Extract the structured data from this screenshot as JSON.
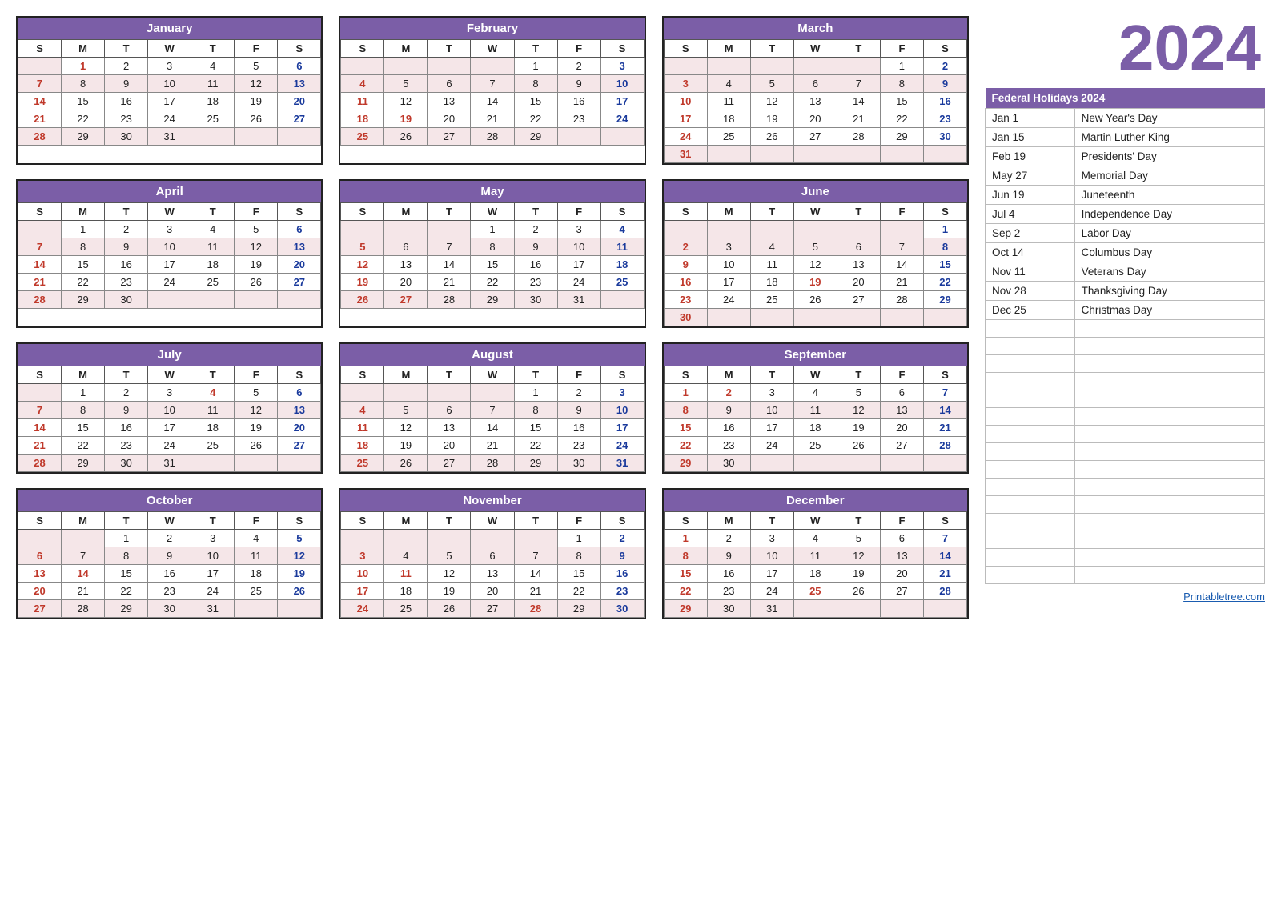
{
  "year": "2024",
  "sidebar": {
    "holidays_header": "Federal Holidays 2024",
    "holidays": [
      {
        "date": "Jan 1",
        "name": "New Year's Day"
      },
      {
        "date": "Jan 15",
        "name": "Martin Luther King"
      },
      {
        "date": "Feb 19",
        "name": "Presidents' Day"
      },
      {
        "date": "May 27",
        "name": "Memorial Day"
      },
      {
        "date": "Jun 19",
        "name": "Juneteenth"
      },
      {
        "date": "Jul 4",
        "name": "Independence Day"
      },
      {
        "date": "Sep 2",
        "name": "Labor Day"
      },
      {
        "date": "Oct 14",
        "name": "Columbus Day"
      },
      {
        "date": "Nov 11",
        "name": "Veterans Day"
      },
      {
        "date": "Nov 28",
        "name": "Thanksgiving Day"
      },
      {
        "date": "Dec 25",
        "name": "Christmas Day"
      }
    ],
    "website": "Printabletree.com"
  },
  "months": [
    {
      "name": "January",
      "weeks": [
        [
          "",
          "1",
          "2",
          "3",
          "4",
          "5",
          "6"
        ],
        [
          "7",
          "8",
          "9",
          "10",
          "11",
          "12",
          "13"
        ],
        [
          "14",
          "15",
          "16",
          "17",
          "18",
          "19",
          "20"
        ],
        [
          "21",
          "22",
          "23",
          "24",
          "25",
          "26",
          "27"
        ],
        [
          "28",
          "29",
          "30",
          "31",
          "",
          "",
          ""
        ]
      ],
      "holidays": [
        "1"
      ],
      "sundays": [
        "7",
        "14",
        "21",
        "28"
      ],
      "saturdays": [
        "6",
        "13",
        "20",
        "27"
      ]
    },
    {
      "name": "February",
      "weeks": [
        [
          "",
          "",
          "",
          "",
          "1",
          "2",
          "3"
        ],
        [
          "4",
          "5",
          "6",
          "7",
          "8",
          "9",
          "10"
        ],
        [
          "11",
          "12",
          "13",
          "14",
          "15",
          "16",
          "17"
        ],
        [
          "18",
          "19",
          "20",
          "21",
          "22",
          "23",
          "24"
        ],
        [
          "25",
          "26",
          "27",
          "28",
          "29",
          "",
          ""
        ]
      ],
      "holidays": [
        "19"
      ],
      "sundays": [
        "4",
        "11",
        "18",
        "25"
      ],
      "saturdays": [
        "3",
        "10",
        "17",
        "24"
      ]
    },
    {
      "name": "March",
      "weeks": [
        [
          "",
          "",
          "",
          "",
          "",
          "1",
          "2"
        ],
        [
          "3",
          "4",
          "5",
          "6",
          "7",
          "8",
          "9"
        ],
        [
          "10",
          "11",
          "12",
          "13",
          "14",
          "15",
          "16"
        ],
        [
          "17",
          "18",
          "19",
          "20",
          "21",
          "22",
          "23"
        ],
        [
          "24",
          "25",
          "26",
          "27",
          "28",
          "29",
          "30"
        ],
        [
          "31",
          "",
          "",
          "",
          "",
          "",
          ""
        ]
      ],
      "holidays": [],
      "sundays": [
        "3",
        "10",
        "17",
        "24",
        "31"
      ],
      "saturdays": [
        "2",
        "9",
        "16",
        "23",
        "30"
      ]
    },
    {
      "name": "April",
      "weeks": [
        [
          "",
          "1",
          "2",
          "3",
          "4",
          "5",
          "6"
        ],
        [
          "7",
          "8",
          "9",
          "10",
          "11",
          "12",
          "13"
        ],
        [
          "14",
          "15",
          "16",
          "17",
          "18",
          "19",
          "20"
        ],
        [
          "21",
          "22",
          "23",
          "24",
          "25",
          "26",
          "27"
        ],
        [
          "28",
          "29",
          "30",
          "",
          "",
          "",
          ""
        ]
      ],
      "holidays": [],
      "sundays": [
        "7",
        "14",
        "21",
        "28"
      ],
      "saturdays": [
        "6",
        "13",
        "20",
        "27"
      ]
    },
    {
      "name": "May",
      "weeks": [
        [
          "",
          "",
          "",
          "1",
          "2",
          "3",
          "4"
        ],
        [
          "5",
          "6",
          "7",
          "8",
          "9",
          "10",
          "11"
        ],
        [
          "12",
          "13",
          "14",
          "15",
          "16",
          "17",
          "18"
        ],
        [
          "19",
          "20",
          "21",
          "22",
          "23",
          "24",
          "25"
        ],
        [
          "26",
          "27",
          "28",
          "29",
          "30",
          "31",
          ""
        ]
      ],
      "holidays": [
        "27"
      ],
      "sundays": [
        "5",
        "12",
        "19",
        "26"
      ],
      "saturdays": [
        "4",
        "11",
        "18",
        "25"
      ]
    },
    {
      "name": "June",
      "weeks": [
        [
          "",
          "",
          "",
          "",
          "",
          "",
          "1"
        ],
        [
          "2",
          "3",
          "4",
          "5",
          "6",
          "7",
          "8"
        ],
        [
          "9",
          "10",
          "11",
          "12",
          "13",
          "14",
          "15"
        ],
        [
          "16",
          "17",
          "18",
          "19",
          "20",
          "21",
          "22"
        ],
        [
          "23",
          "24",
          "25",
          "26",
          "27",
          "28",
          "29"
        ],
        [
          "30",
          "",
          "",
          "",
          "",
          "",
          ""
        ]
      ],
      "holidays": [
        "19"
      ],
      "sundays": [
        "2",
        "9",
        "16",
        "23",
        "30"
      ],
      "saturdays": [
        "1",
        "8",
        "15",
        "22",
        "29"
      ]
    },
    {
      "name": "July",
      "weeks": [
        [
          "",
          "1",
          "2",
          "3",
          "4",
          "5",
          "6"
        ],
        [
          "7",
          "8",
          "9",
          "10",
          "11",
          "12",
          "13"
        ],
        [
          "14",
          "15",
          "16",
          "17",
          "18",
          "19",
          "20"
        ],
        [
          "21",
          "22",
          "23",
          "24",
          "25",
          "26",
          "27"
        ],
        [
          "28",
          "29",
          "30",
          "31",
          "",
          "",
          ""
        ]
      ],
      "holidays": [
        "4"
      ],
      "sundays": [
        "7",
        "14",
        "21",
        "28"
      ],
      "saturdays": [
        "6",
        "13",
        "20",
        "27"
      ]
    },
    {
      "name": "August",
      "weeks": [
        [
          "",
          "",
          "",
          "",
          "1",
          "2",
          "3"
        ],
        [
          "4",
          "5",
          "6",
          "7",
          "8",
          "9",
          "10"
        ],
        [
          "11",
          "12",
          "13",
          "14",
          "15",
          "16",
          "17"
        ],
        [
          "18",
          "19",
          "20",
          "21",
          "22",
          "23",
          "24"
        ],
        [
          "25",
          "26",
          "27",
          "28",
          "29",
          "30",
          "31"
        ]
      ],
      "holidays": [],
      "sundays": [
        "4",
        "11",
        "18",
        "25"
      ],
      "saturdays": [
        "3",
        "10",
        "17",
        "24",
        "31"
      ]
    },
    {
      "name": "September",
      "weeks": [
        [
          "1",
          "2",
          "3",
          "4",
          "5",
          "6",
          "7"
        ],
        [
          "8",
          "9",
          "10",
          "11",
          "12",
          "13",
          "14"
        ],
        [
          "15",
          "16",
          "17",
          "18",
          "19",
          "20",
          "21"
        ],
        [
          "22",
          "23",
          "24",
          "25",
          "26",
          "27",
          "28"
        ],
        [
          "29",
          "30",
          "",
          "",
          "",
          "",
          ""
        ]
      ],
      "holidays": [
        "2"
      ],
      "sundays": [
        "1",
        "8",
        "15",
        "22",
        "29"
      ],
      "saturdays": [
        "7",
        "14",
        "21",
        "28"
      ]
    },
    {
      "name": "October",
      "weeks": [
        [
          "",
          "",
          "1",
          "2",
          "3",
          "4",
          "5"
        ],
        [
          "6",
          "7",
          "8",
          "9",
          "10",
          "11",
          "12"
        ],
        [
          "13",
          "14",
          "15",
          "16",
          "17",
          "18",
          "19"
        ],
        [
          "20",
          "21",
          "22",
          "23",
          "24",
          "25",
          "26"
        ],
        [
          "27",
          "28",
          "29",
          "30",
          "31",
          "",
          ""
        ]
      ],
      "holidays": [
        "14"
      ],
      "sundays": [
        "6",
        "13",
        "20",
        "27"
      ],
      "saturdays": [
        "5",
        "12",
        "19",
        "26"
      ]
    },
    {
      "name": "November",
      "weeks": [
        [
          "",
          "",
          "",
          "",
          "",
          "1",
          "2"
        ],
        [
          "3",
          "4",
          "5",
          "6",
          "7",
          "8",
          "9"
        ],
        [
          "10",
          "11",
          "12",
          "13",
          "14",
          "15",
          "16"
        ],
        [
          "17",
          "18",
          "19",
          "20",
          "21",
          "22",
          "23"
        ],
        [
          "24",
          "25",
          "26",
          "27",
          "28",
          "29",
          "30"
        ]
      ],
      "holidays": [
        "11",
        "28"
      ],
      "sundays": [
        "3",
        "10",
        "17",
        "24"
      ],
      "saturdays": [
        "2",
        "9",
        "16",
        "23",
        "30"
      ]
    },
    {
      "name": "December",
      "weeks": [
        [
          "1",
          "2",
          "3",
          "4",
          "5",
          "6",
          "7"
        ],
        [
          "8",
          "9",
          "10",
          "11",
          "12",
          "13",
          "14"
        ],
        [
          "15",
          "16",
          "17",
          "18",
          "19",
          "20",
          "21"
        ],
        [
          "22",
          "23",
          "24",
          "25",
          "26",
          "27",
          "28"
        ],
        [
          "29",
          "30",
          "31",
          "",
          "",
          "",
          ""
        ]
      ],
      "holidays": [
        "25"
      ],
      "sundays": [
        "1",
        "8",
        "15",
        "22",
        "29"
      ],
      "saturdays": [
        "7",
        "14",
        "21",
        "28"
      ]
    }
  ],
  "days_header": [
    "S",
    "M",
    "T",
    "W",
    "T",
    "F",
    "S"
  ]
}
